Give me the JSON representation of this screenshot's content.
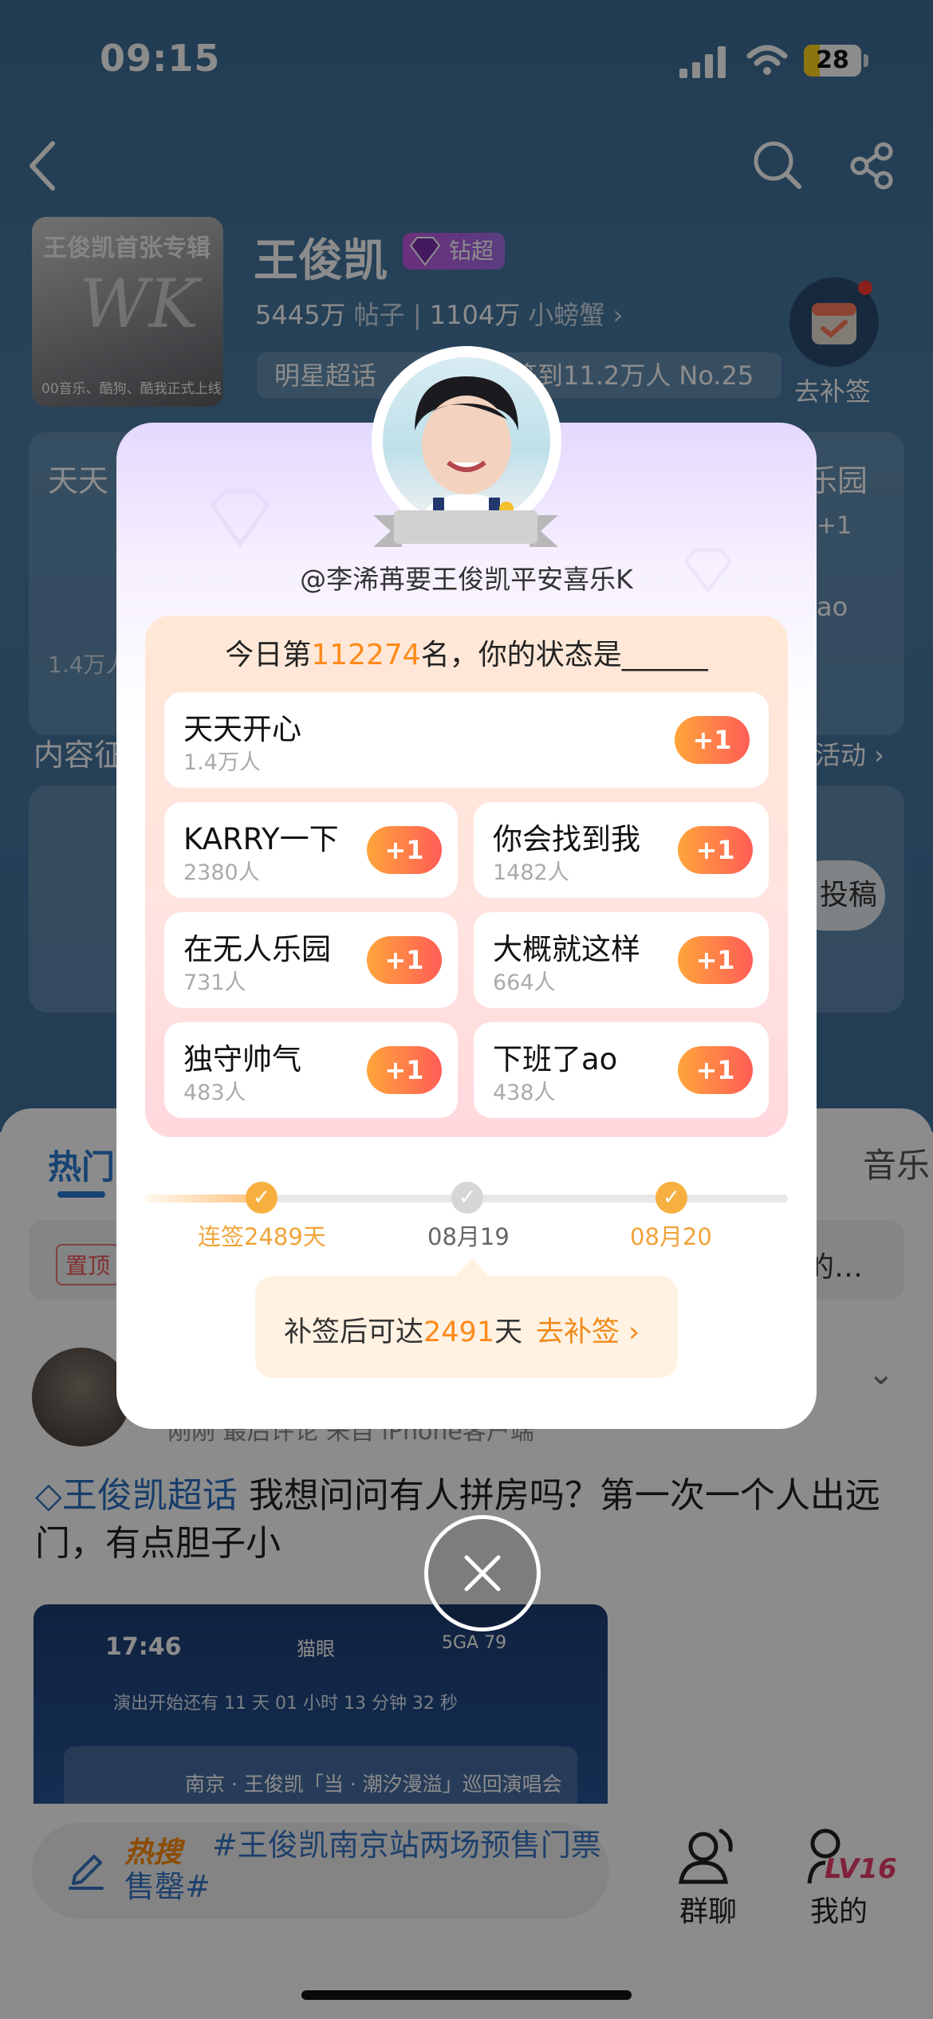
{
  "status_bar": {
    "time": "09:15",
    "battery": "28",
    "battery_level": 0.28
  },
  "header": {
    "title": "王俊凯",
    "level_badge": "钻超",
    "posts": "5445万",
    "posts_label": "帖子",
    "fans": "1104万",
    "fans_label": "小螃蟹",
    "tag": "明星超话",
    "checkin_rank": "签到11.2万人 No.25",
    "checkin_button": "去补签",
    "album_title": "王俊凯首张专辑",
    "album_footer": "00音乐、酷狗、酷我正式上线",
    "album_art": "WK"
  },
  "background_cards": {
    "left_title": "天天",
    "right_title": "乐园",
    "left_count": "1.4万人",
    "plus": "+1",
    "right_small": "ao",
    "content_label": "内容征",
    "activity_link": "活动 ›",
    "submit": "投稿"
  },
  "feed": {
    "tabs": {
      "hot": "热门",
      "music": "音乐"
    },
    "pinned_badge": "置顶",
    "pinned_text": "的…",
    "post_meta": "刚刚 最后评论 来自 iPhone客户端",
    "post_topic": "王俊凯超话",
    "post_body": "我想问问有人拼房吗？第一次一个人出远门，有点胆子小",
    "image": {
      "time": "17:46",
      "app": "猫眼",
      "signal": "5GA 79",
      "countdown": "演出开始还有 11 天 01 小时 13 分钟 32 秒",
      "title": "南京 · 王俊凯「当 · 潮汐漫溢」巡回演唱会"
    }
  },
  "bottom_nav": {
    "compose_hot": "热搜",
    "compose_text": "#王俊凯南京站两场预售门票售罄#",
    "chat": "群聊",
    "me": "我的",
    "level": "LV16"
  },
  "modal": {
    "username": "@李浠苒要王俊凯平安喜乐K",
    "rank_prefix": "今日第",
    "rank_number": "112274",
    "rank_suffix": "名，你的状态是______",
    "options": [
      {
        "label": "天天开心",
        "count": "1.4万人",
        "plus": "+1"
      },
      {
        "label": "KARRY一下",
        "count": "2380人",
        "plus": "+1"
      },
      {
        "label": "你会找到我",
        "count": "1482人",
        "plus": "+1"
      },
      {
        "label": "在无人乐园",
        "count": "731人",
        "plus": "+1"
      },
      {
        "label": "大概就这样",
        "count": "664人",
        "plus": "+1"
      },
      {
        "label": "独守帅气",
        "count": "483人",
        "plus": "+1"
      },
      {
        "label": "下班了ao",
        "count": "438人",
        "plus": "+1"
      }
    ],
    "timeline": [
      {
        "label": "连签2489天",
        "state": "done"
      },
      {
        "label": "08月19",
        "state": "missed"
      },
      {
        "label": "08月20",
        "state": "done"
      }
    ],
    "callout_prefix": "补签后可达",
    "callout_number": "2491",
    "callout_suffix": "天",
    "callout_action": "去补签 ›"
  },
  "colors": {
    "accent_orange": "#ff8a1a",
    "link_blue": "#2a7ad1",
    "hero_blue": "#4a7ca5"
  }
}
